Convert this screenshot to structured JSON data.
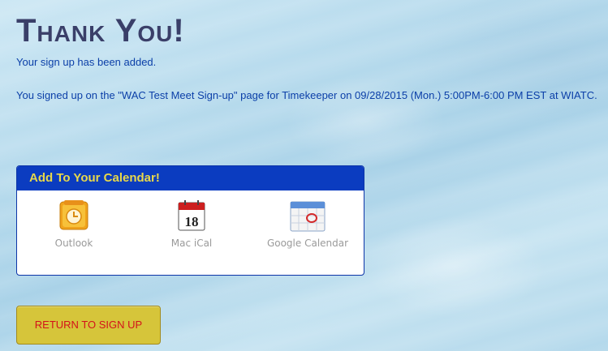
{
  "header": {
    "title": "Thank You!"
  },
  "messages": {
    "added": "Your sign up has been added.",
    "details": "You signed up on the \"WAC Test Meet Sign-up\" page for Timekeeper on 09/28/2015 (Mon.) 5:00PM-6:00 PM EST at WIATC."
  },
  "calendar": {
    "heading": "Add To Your Calendar!",
    "options": [
      {
        "label": "Outlook",
        "icon": "outlook-icon"
      },
      {
        "label": "Mac iCal",
        "icon": "ical-icon",
        "day": "18"
      },
      {
        "label": "Google Calendar",
        "icon": "google-calendar-icon"
      }
    ]
  },
  "buttons": {
    "return": "RETURN TO SIGN UP"
  },
  "colors": {
    "title": "#3a3f69",
    "text": "#0b3fa8",
    "calendar_header": "#0b3cc0",
    "calendar_header_text": "#e8d84a",
    "button": "#d6c53a",
    "button_text": "#d4121a"
  }
}
